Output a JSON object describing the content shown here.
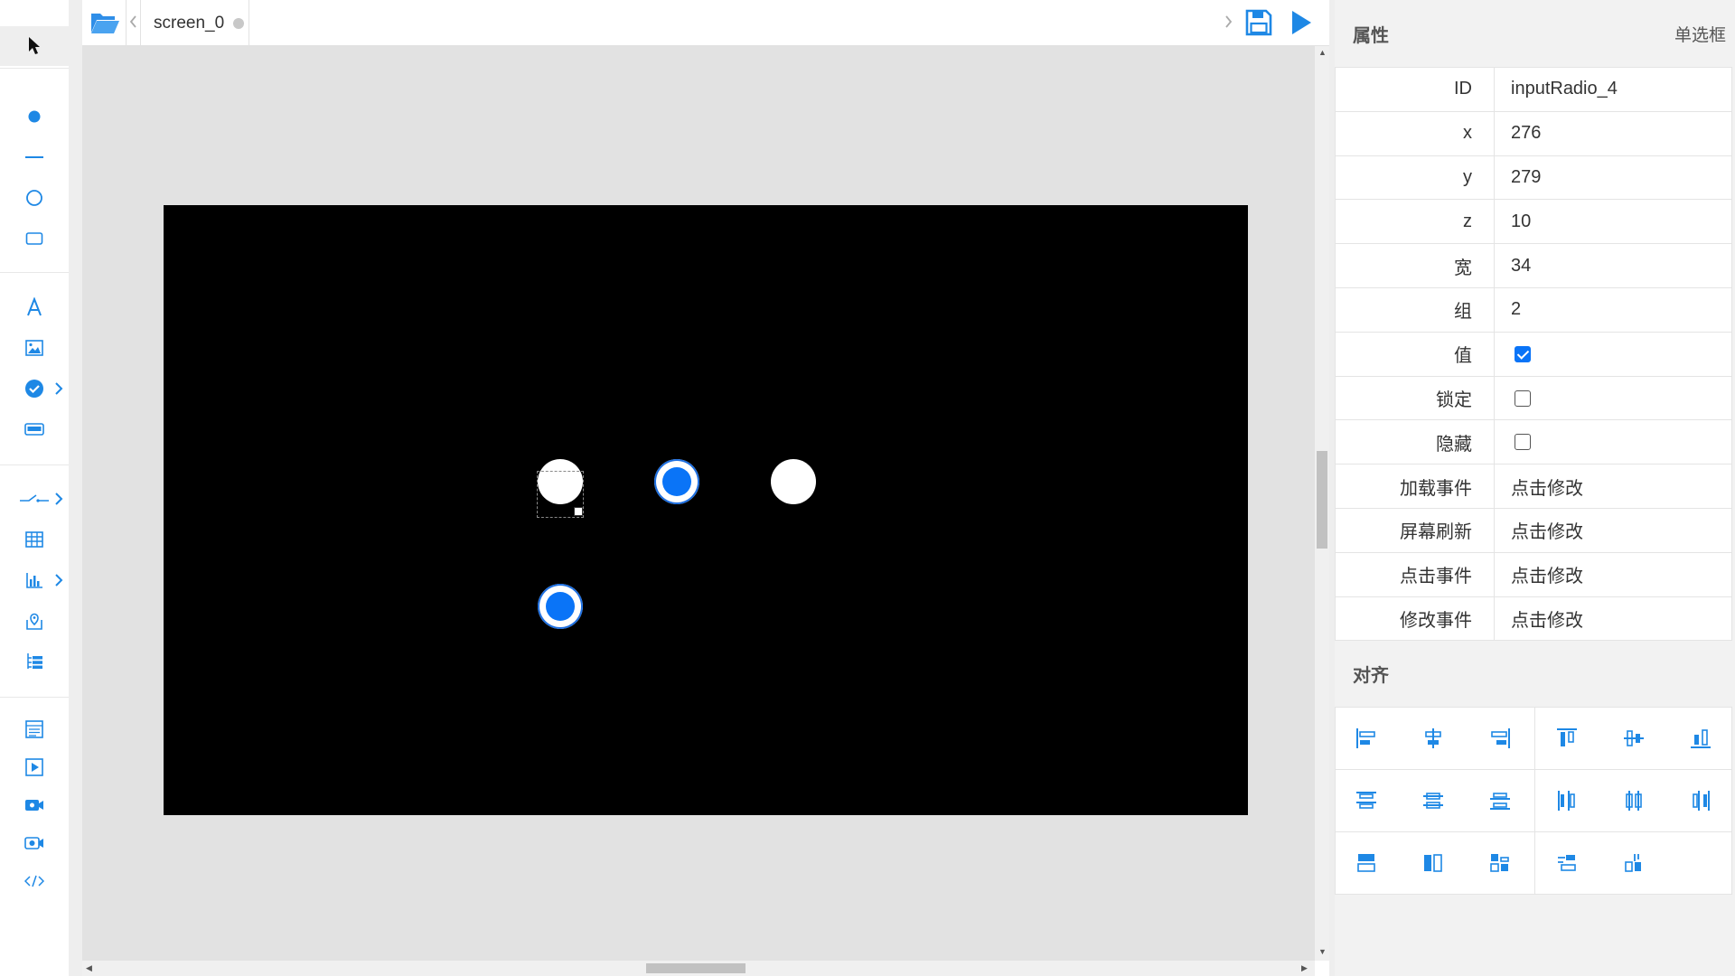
{
  "tabs": [
    {
      "label": "screen_0",
      "unsaved": true
    }
  ],
  "toolbar": {
    "tools": [
      {
        "name": "select-tool",
        "icon": "cursor-arrow-icon",
        "active": true
      },
      {
        "name": "point-tool",
        "icon": "dot-icon"
      },
      {
        "name": "line-tool",
        "icon": "line-icon"
      },
      {
        "name": "circle-tool",
        "icon": "circle-icon"
      },
      {
        "name": "rect-tool",
        "icon": "rectangle-icon"
      },
      {
        "name": "text-tool",
        "icon": "text-a-icon"
      },
      {
        "name": "image-tool",
        "icon": "image-icon"
      },
      {
        "name": "check-tool",
        "icon": "check-circle-icon",
        "submenu": true
      },
      {
        "name": "input-tool",
        "icon": "input-box-icon"
      },
      {
        "name": "switch-tool",
        "icon": "switch-icon",
        "submenu": true
      },
      {
        "name": "table-tool",
        "icon": "table-icon"
      },
      {
        "name": "chart-tool",
        "icon": "bar-chart-icon",
        "submenu": true
      },
      {
        "name": "map-tool",
        "icon": "map-pin-icon"
      },
      {
        "name": "tree-tool",
        "icon": "tree-list-icon"
      },
      {
        "name": "page-tool",
        "icon": "page-icon"
      },
      {
        "name": "media-tool",
        "icon": "play-box-icon"
      },
      {
        "name": "video-tool",
        "icon": "video-camera-icon"
      },
      {
        "name": "camera-tool",
        "icon": "camera-icon"
      },
      {
        "name": "code-tool",
        "icon": "code-icon"
      }
    ]
  },
  "canvas": {
    "radios": [
      {
        "id": "radio-1",
        "checked": false
      },
      {
        "id": "radio-2",
        "checked": true
      },
      {
        "id": "radio-3",
        "checked": false
      },
      {
        "id": "radio-4",
        "checked": true,
        "selected": true
      }
    ]
  },
  "properties": {
    "title": "属性",
    "type": "单选框",
    "rows": [
      {
        "key": "ID",
        "value": "inputRadio_4"
      },
      {
        "key": "x",
        "value": "276"
      },
      {
        "key": "y",
        "value": "279"
      },
      {
        "key": "z",
        "value": "10"
      },
      {
        "key": "宽",
        "value": "34"
      },
      {
        "key": "组",
        "value": "2"
      },
      {
        "key": "值",
        "checkbox": true,
        "checked": true
      },
      {
        "key": "锁定",
        "checkbox": true,
        "checked": false
      },
      {
        "key": "隐藏",
        "checkbox": true,
        "checked": false
      },
      {
        "key": "加载事件",
        "value": "点击修改"
      },
      {
        "key": "屏幕刷新",
        "value": "点击修改"
      },
      {
        "key": "点击事件",
        "value": "点击修改"
      },
      {
        "key": "修改事件",
        "value": "点击修改"
      }
    ]
  },
  "align": {
    "title": "对齐",
    "buttons": [
      "align-left-icon",
      "align-center-h-icon",
      "align-right-icon",
      "align-top-icon",
      "align-middle-v-icon",
      "align-bottom-icon",
      "distribute-top-icon",
      "distribute-center-h-icon",
      "distribute-bottom-icon",
      "distribute-left-icon",
      "distribute-center-v-icon",
      "distribute-right-icon",
      "same-width-icon",
      "same-height-icon",
      "same-size-icon",
      "space-horizontal-icon",
      "space-vertical-icon"
    ]
  },
  "colors": {
    "accent": "#0a74f7",
    "workspace": "#e2e2e2",
    "canvas": "#000000"
  }
}
